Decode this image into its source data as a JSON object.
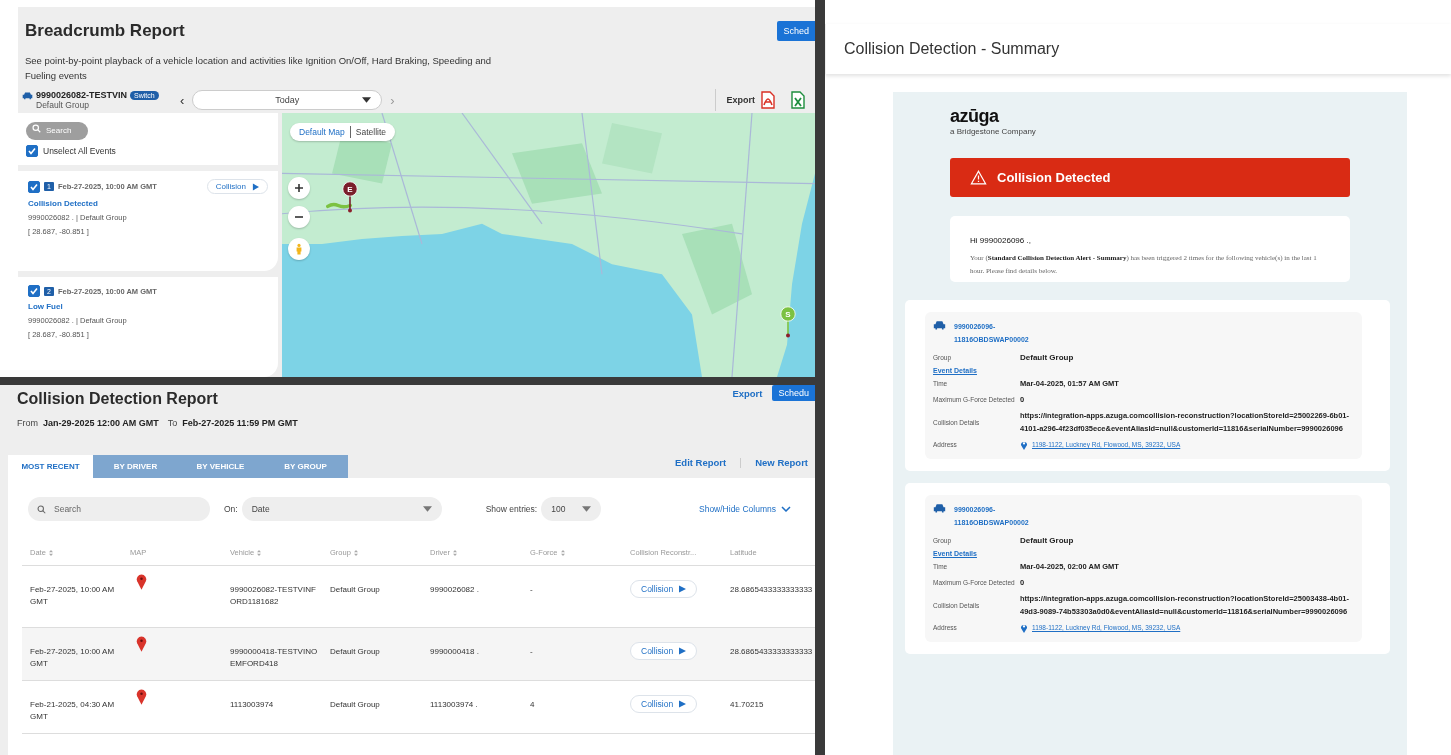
{
  "breadcrumb": {
    "title": "Breadcrumb Report",
    "description": "See point-by-point playback of a vehicle location and activities like Ignition On/Off, Hard Braking, Speeding and Fueling events",
    "schedule_button": "Sched",
    "vehicle": {
      "name": "9990026082-TESTVIN",
      "badge": "Switch",
      "group": "Default Group"
    },
    "date_picker": {
      "prev": "‹",
      "value": "Today",
      "next": "›",
      "next_disabled": true
    },
    "export": {
      "label": "Export"
    },
    "search": {
      "placeholder": "Search"
    },
    "unselect_all": {
      "label": "Unselect All Events",
      "checked": true
    },
    "events": [
      {
        "number": "1",
        "time": "Feb-27-2025, 10:00 AM GMT",
        "title": "Collision Detected",
        "vehicle": "9990026082 . | Default Group",
        "coords": "[ 28.687, -80.851 ]",
        "checked": true,
        "action": "Collision"
      },
      {
        "number": "2",
        "time": "Feb-27-2025, 10:00 AM GMT",
        "title": "Low Fuel",
        "vehicle": "9990026082 . | Default Group",
        "coords": "[ 28.687, -80.851 ]",
        "checked": true
      }
    ],
    "map": {
      "kind": "picture",
      "modes": [
        {
          "label": "Default Map",
          "selected": true
        },
        {
          "label": "Satellite",
          "selected": false
        }
      ],
      "markers": [
        {
          "label": "E",
          "kind": "end"
        },
        {
          "label": "S",
          "kind": "start"
        }
      ]
    }
  },
  "collision_report": {
    "title": "Collision Detection Report",
    "range": {
      "from_label": "From",
      "from": "Jan-29-2025 12:00 AM GMT",
      "to_label": "To",
      "to": "Feb-27-2025 11:59 PM GMT"
    },
    "export": "Export",
    "schedule_button": "Schedu",
    "tabs": [
      {
        "label": "MOST RECENT",
        "selected": true
      },
      {
        "label": "BY DRIVER",
        "selected": false
      },
      {
        "label": "BY VEHICLE",
        "selected": false
      },
      {
        "label": "BY GROUP",
        "selected": false
      }
    ],
    "links": [
      "Edit Report",
      "New Report"
    ],
    "search": {
      "placeholder": "Search"
    },
    "on": {
      "label": "On:",
      "value": "Date"
    },
    "entries": {
      "label": "Show entries:",
      "value": "100"
    },
    "columns_toggle": "Show/Hide Columns",
    "columns": [
      {
        "label": "Date",
        "sortable": true
      },
      {
        "label": "MAP",
        "sortable": false
      },
      {
        "label": "Vehicle",
        "sortable": true
      },
      {
        "label": "Group",
        "sortable": true
      },
      {
        "label": "Driver",
        "sortable": true
      },
      {
        "label": "G-Force",
        "sortable": true
      },
      {
        "label": "Collision Reconstr...",
        "sortable": false
      },
      {
        "label": "Latitude",
        "sortable": false
      }
    ],
    "rows": [
      {
        "date": "Feb-27-2025, 10:00 AM GMT",
        "vehicle": "9990026082-TESTVINFORD1181682",
        "group": "Default Group",
        "driver": "9990026082 .",
        "g_force": "-",
        "action": "Collision",
        "latitude": "28.6865433333333333"
      },
      {
        "date": "Feb-27-2025, 10:00 AM GMT",
        "vehicle": "9990000418-TESTVINOEMFORD418",
        "group": "Default Group",
        "driver": "9990000418 .",
        "g_force": "-",
        "action": "Collision",
        "latitude": "28.6865433333333333"
      },
      {
        "date": "Feb-21-2025, 04:30 AM GMT",
        "vehicle": "1113003974",
        "group": "Default Group",
        "driver": "1113003974 .",
        "g_force": "4",
        "action": "Collision",
        "latitude": "41.70215"
      }
    ]
  },
  "email": {
    "header": "Collision Detection - Summary",
    "logo": {
      "name": "azūga",
      "tagline": "a Bridgestone Company"
    },
    "alert": "Collision Detected",
    "greeting": "Hi 9990026096 .,",
    "message": "Your (**Standard Collision Detection Alert - Summary**) has been triggered 2 times for the following vehicle(s) in the last 1 hour. Please find details below.",
    "vehicles": [
      {
        "name": "9990026096-11816OBDSWAP00002",
        "group_label": "Group",
        "group": "Default Group",
        "section": "Event Details",
        "fields": [
          {
            "label": "Time",
            "value": "Mar-04-2025, 01:57 AM GMT",
            "kind": "text"
          },
          {
            "label": "Maximum G-Force Detected",
            "value": "0",
            "kind": "text"
          },
          {
            "label": "Collision Details",
            "value": "https://integration-apps.azuga.comcollision-reconstruction?locationStoreId=25002269-6b01-4101-a296-4f23df035ece&eventAliasId=null&customerId=11816&serialNumber=9990026096",
            "kind": "text"
          },
          {
            "label": "Address",
            "value": "1198-1122, Luckney Rd, Flowood, MS, 39232, USA",
            "kind": "address"
          }
        ]
      },
      {
        "name": "9990026096-11816OBDSWAP00002",
        "group_label": "Group",
        "group": "Default Group",
        "section": "Event Details",
        "fields": [
          {
            "label": "Time",
            "value": "Mar-04-2025, 02:00 AM GMT",
            "kind": "text"
          },
          {
            "label": "Maximum G-Force Detected",
            "value": "0",
            "kind": "text"
          },
          {
            "label": "Collision Details",
            "value": "https://integration-apps.azuga.comcollision-reconstruction?locationStoreId=25003438-4b01-49d3-9089-74b53303a0d0&eventAliasId=null&customerId=11816&serialNumber=9990026096",
            "kind": "text"
          },
          {
            "label": "Address",
            "value": "1198-1122, Luckney Rd, Flowood, MS, 39232, USA",
            "kind": "address"
          }
        ]
      }
    ]
  }
}
